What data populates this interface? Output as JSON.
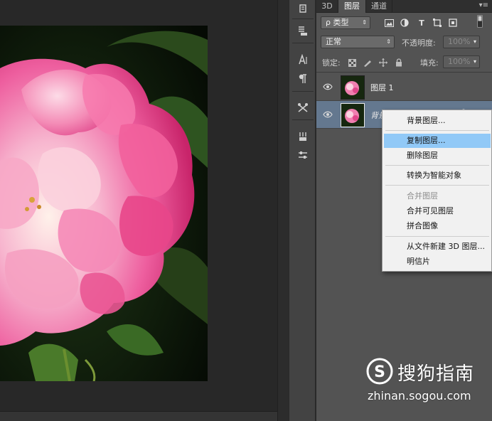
{
  "panel": {
    "tabs": [
      {
        "label": "3D"
      },
      {
        "label": "图层"
      },
      {
        "label": "通道"
      }
    ],
    "filter": {
      "label": "ρ 类型"
    },
    "blend_mode": {
      "value": "正常"
    },
    "opacity": {
      "label": "不透明度:",
      "value": "100%"
    },
    "lock": {
      "label": "锁定:"
    },
    "fill": {
      "label": "填充:",
      "value": "100%"
    }
  },
  "layers": [
    {
      "name": "图层 1"
    },
    {
      "name": "背景"
    }
  ],
  "context_menu": {
    "items": [
      {
        "label": "背景图层..."
      },
      {
        "label": "复制图层..."
      },
      {
        "label": "删除图层"
      },
      {
        "label": "转换为智能对象"
      },
      {
        "label": "合并图层"
      },
      {
        "label": "合并可见图层"
      },
      {
        "label": "拼合图像"
      },
      {
        "label": "从文件新建 3D 图层..."
      },
      {
        "label": "明信片"
      }
    ],
    "highlight_color": "#91c9f7"
  },
  "watermark": {
    "brand": "搜狗指南",
    "url": "zhinan.sogou.com"
  },
  "colors": {
    "panel_bg": "#535353",
    "selected_layer": "#64788f",
    "canvas_bg": "#282828"
  }
}
